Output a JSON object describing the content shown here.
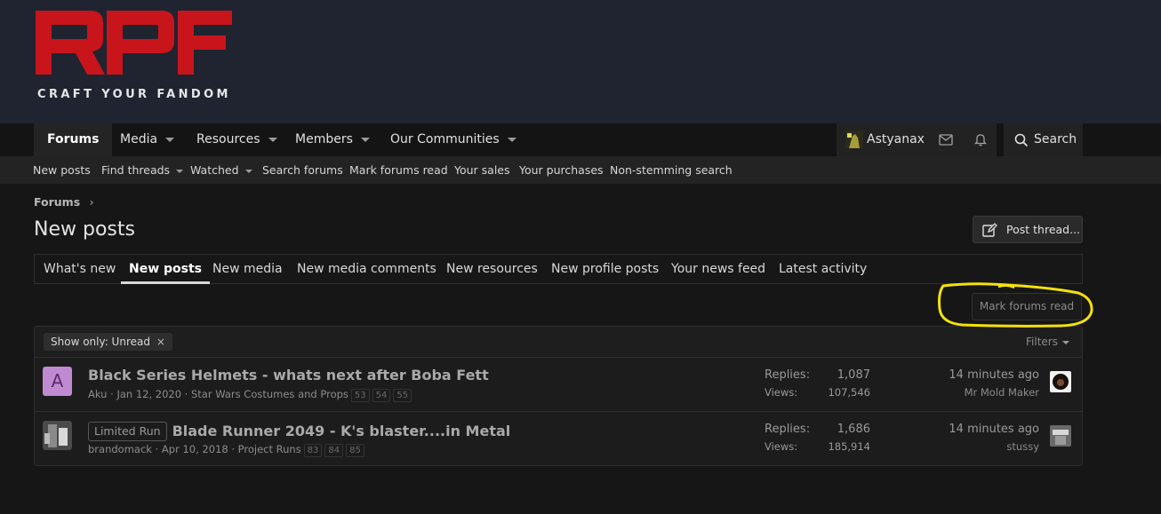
{
  "logo": {
    "text": "RPF",
    "tagline": "CRAFT YOUR FANDOM"
  },
  "nav": {
    "items": [
      {
        "label": "Forums",
        "active": true
      },
      {
        "label": "Media",
        "dropdown": true
      },
      {
        "label": "Resources",
        "dropdown": true
      },
      {
        "label": "Members",
        "dropdown": true
      },
      {
        "label": "Our Communities",
        "dropdown": true
      }
    ],
    "username": "Astyanax",
    "search_label": "Search"
  },
  "subnav": {
    "items": [
      {
        "label": "New posts"
      },
      {
        "label": "Find threads",
        "dropdown": true
      },
      {
        "label": "Watched",
        "dropdown": true
      },
      {
        "label": "Search forums"
      },
      {
        "label": "Mark forums read"
      },
      {
        "label": "Your sales"
      },
      {
        "label": "Your purchases"
      },
      {
        "label": "Non-stemming search"
      }
    ]
  },
  "breadcrumb": {
    "label": "Forums"
  },
  "page": {
    "title": "New posts",
    "post_thread_label": "Post thread..."
  },
  "tabs": [
    {
      "label": "What's new"
    },
    {
      "label": "New posts",
      "active": true
    },
    {
      "label": "New media"
    },
    {
      "label": "New media comments"
    },
    {
      "label": "New resources"
    },
    {
      "label": "New profile posts"
    },
    {
      "label": "Your news feed"
    },
    {
      "label": "Latest activity"
    }
  ],
  "mark_read_label": "Mark forums read",
  "filter": {
    "chip_label": "Show only: Unread",
    "filters_label": "Filters"
  },
  "threads": [
    {
      "avatar_letter": "A",
      "prefix": "",
      "title": "Black Series Helmets - whats next after Boba Fett",
      "author": "Aku",
      "date": "Jan 12, 2020",
      "forum": "Star Wars Costumes and Props",
      "pages": [
        "53",
        "54",
        "55"
      ],
      "replies_label": "Replies:",
      "replies": "1,087",
      "views_label": "Views:",
      "views": "107,546",
      "last_time": "14 minutes ago",
      "last_user": "Mr Mold Maker"
    },
    {
      "avatar_letter": "",
      "prefix": "Limited Run",
      "title": "Blade Runner 2049 - K's blaster....in Metal",
      "author": "brandomack",
      "date": "Apr 10, 2018",
      "forum": "Project Runs",
      "pages": [
        "83",
        "84",
        "85"
      ],
      "replies_label": "Replies:",
      "replies": "1,686",
      "views_label": "Views:",
      "views": "185,914",
      "last_time": "14 minutes ago",
      "last_user": "stussy"
    }
  ],
  "colors": {
    "brand_red": "#c8141b",
    "header_bg": "#1f2430",
    "highlight": "#f5e20a"
  }
}
